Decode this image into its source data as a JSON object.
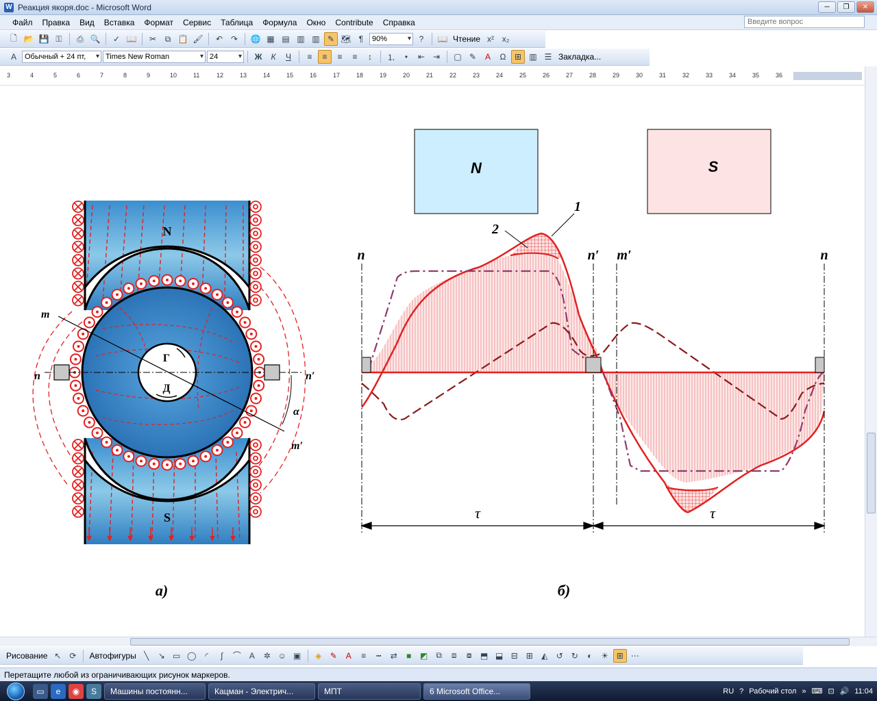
{
  "window": {
    "title": "Реакция якоря.doc - Microsoft Word"
  },
  "menu": {
    "items": [
      "Файл",
      "Правка",
      "Вид",
      "Вставка",
      "Формат",
      "Сервис",
      "Таблица",
      "Формула",
      "Окно",
      "Contribute",
      "Справка"
    ],
    "help_placeholder": "Введите вопрос"
  },
  "toolbar1": {
    "zoom": "90%",
    "reading": "Чтение"
  },
  "toolbar2": {
    "style": "Обычный + 24 пт,",
    "font": "Times New Roman",
    "size": "24",
    "bookmark": "Закладка..."
  },
  "ruler": {
    "marks": [
      "3",
      "4",
      "5",
      "6",
      "7",
      "8",
      "9",
      "10",
      "11",
      "12",
      "13",
      "14",
      "15",
      "16",
      "17",
      "18",
      "19",
      "20",
      "21",
      "22",
      "23",
      "24",
      "25",
      "26",
      "27",
      "28",
      "29",
      "30",
      "31",
      "32",
      "33",
      "34",
      "35",
      "36"
    ]
  },
  "figure": {
    "left": {
      "pole_n": "N",
      "pole_s": "S",
      "gen": "Г",
      "motor": "Д",
      "label_m": "m",
      "label_n": "n",
      "label_n_prime": "n′",
      "label_m_prime": "m′",
      "label_alpha": "α",
      "caption": "а)"
    },
    "right": {
      "pole_n": "N",
      "pole_s": "S",
      "label_1": "1",
      "label_2": "2",
      "label_n_left": "n",
      "label_n_prime": "n′",
      "label_m_prime": "m′",
      "label_n_right": "n",
      "tau_1": "τ",
      "tau_2": "τ",
      "caption": "б)"
    }
  },
  "drawbar": {
    "draw": "Рисование",
    "autoshapes": "Автофигуры"
  },
  "status": {
    "text": "Перетащите любой из ограничивающих рисунок маркеров."
  },
  "taskbar": {
    "tasks": [
      "Машины постоянн...",
      "Кацман - Электрич...",
      "МПТ",
      "6 Microsoft Office..."
    ],
    "lang": "RU",
    "desktop": "Рабочий стол",
    "time": "11:04"
  },
  "colors": {
    "red": "#e32020",
    "hatch": "#f4b6b6",
    "pole_n": "#cdeefe",
    "pole_s": "#fde3e3",
    "blue": "#3a8fd0"
  }
}
